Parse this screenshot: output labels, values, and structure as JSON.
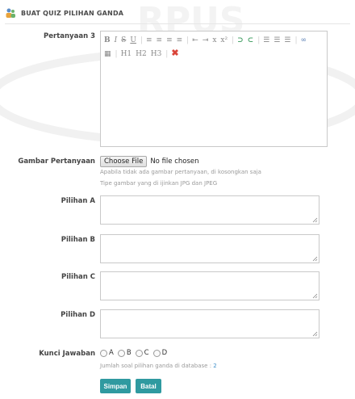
{
  "header": {
    "title": "BUAT QUIZ PILIHAN GANDA",
    "icon": "users-icon"
  },
  "question": {
    "label": "Pertanyaan 3",
    "toolbar": {
      "row1": [
        "B",
        "I",
        "S",
        "U",
        "|",
        "≡",
        "≡",
        "≡",
        "≡",
        "|",
        "⇤",
        "⇥",
        "x",
        "x²",
        "|",
        "⊃",
        "⊂",
        "|",
        "☰",
        "☰",
        "☰",
        "|",
        "∞"
      ],
      "row2": [
        "▦",
        "|",
        "H1",
        "H2",
        "H3",
        "|",
        "✖"
      ]
    },
    "content": ""
  },
  "image": {
    "label": "Gambar Pertanyaan",
    "button_label": "Choose File",
    "status": "No file chosen",
    "hint1": "Apabila tidak ada gambar pertanyaan, di kosongkan saja",
    "hint2": "Tipe gambar yang di ijinkan JPG dan JPEG"
  },
  "options": [
    {
      "label": "Pilihan A",
      "value": ""
    },
    {
      "label": "Pilihan B",
      "value": ""
    },
    {
      "label": "Pilihan C",
      "value": ""
    },
    {
      "label": "Pilihan D",
      "value": ""
    }
  ],
  "answer": {
    "label": "Kunci Jawaban",
    "choices": [
      "A",
      "B",
      "C",
      "D"
    ],
    "count_text": "Jumlah soal pilihan ganda di database : ",
    "count_value": "2"
  },
  "buttons": {
    "save": "Simpan",
    "cancel": "Batal"
  },
  "colors": {
    "accent": "#2f9aa0",
    "link": "#3f8fc9"
  }
}
